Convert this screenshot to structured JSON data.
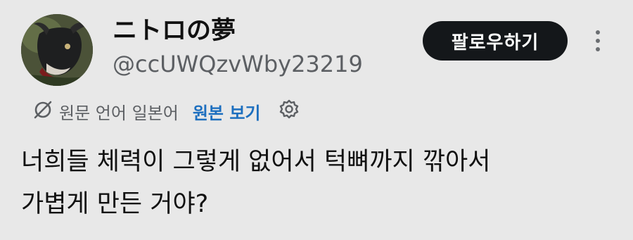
{
  "author": {
    "display_name": "ニトロの夢",
    "handle": "@ccUWQzvWby23219"
  },
  "actions": {
    "follow_label": "팔로우하기"
  },
  "translation": {
    "source_label": "원문 언어 일본어",
    "view_original_label": "원본 보기"
  },
  "tweet": {
    "line1": "너희들 체력이 그렇게 없어서 턱뼈까지 깎아서",
    "line2": "가볍게 만든 거야?"
  },
  "colors": {
    "background": "#e8e8e8",
    "button": "#14171a",
    "link": "#1d6fbf",
    "muted": "#5c5f63"
  },
  "icons": {
    "translate": "no-translate-icon",
    "settings": "gear-icon",
    "more": "more-vertical-icon"
  }
}
